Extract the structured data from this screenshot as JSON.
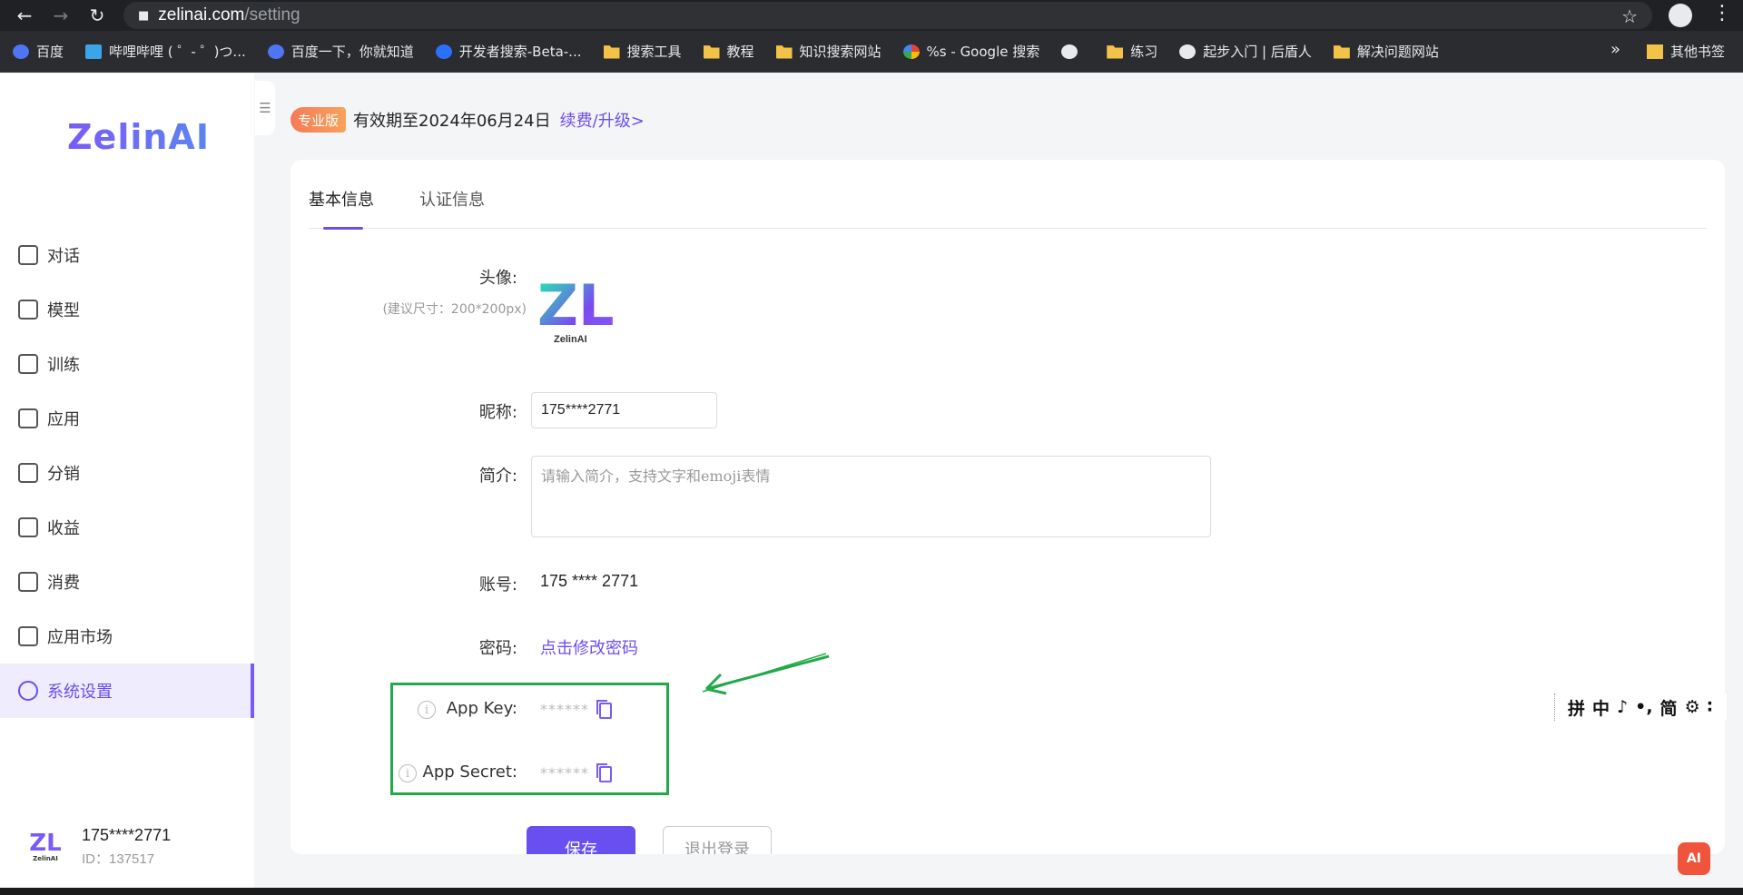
{
  "browser": {
    "url_host": "zelinai.com",
    "url_path": "/setting",
    "bookmarks": [
      {
        "label": "百度",
        "icon": "paw-icon"
      },
      {
        "label": "哔哩哔哩 ( ゜- ゜)つ...",
        "icon": "bilibili-icon"
      },
      {
        "label": "百度一下，你就知道",
        "icon": "paw-icon"
      },
      {
        "label": "开发者搜索-Beta-...",
        "icon": "dev-search-icon"
      },
      {
        "label": "搜索工具",
        "icon": "folder-icon"
      },
      {
        "label": "教程",
        "icon": "folder-icon"
      },
      {
        "label": "知识搜索网站",
        "icon": "folder-icon"
      },
      {
        "label": "%s - Google 搜索",
        "icon": "google-icon"
      },
      {
        "label": "",
        "icon": "globe-icon"
      },
      {
        "label": "练习",
        "icon": "folder-icon"
      },
      {
        "label": "起步入门 | 后盾人",
        "icon": "globe-icon"
      },
      {
        "label": "解决问题网站",
        "icon": "folder-icon"
      }
    ],
    "more_label": "»",
    "other_bookmarks": "其他书签"
  },
  "sidebar": {
    "logo": "ZelinAI",
    "menu": [
      {
        "label": "对话",
        "name": "chat"
      },
      {
        "label": "模型",
        "name": "model"
      },
      {
        "label": "训练",
        "name": "train"
      },
      {
        "label": "应用",
        "name": "apps"
      },
      {
        "label": "分销",
        "name": "distribution"
      },
      {
        "label": "收益",
        "name": "earnings"
      },
      {
        "label": "消费",
        "name": "consumption"
      },
      {
        "label": "应用市场",
        "name": "app-market"
      },
      {
        "label": "系统设置",
        "name": "settings"
      }
    ],
    "user": {
      "avatar_text": "ZL",
      "avatar_sub": "ZelinAI",
      "name": "175****2771",
      "id": "ID：137517"
    }
  },
  "plan": {
    "badge": "专业版",
    "expiry": "有效期至2024年06月24日",
    "renew_link": "续费/升级>"
  },
  "tabs": [
    "基本信息",
    "认证信息"
  ],
  "form": {
    "avatar_label": "头像:",
    "avatar_hint": "(建议尺寸：200*200px)",
    "avatar_text": "ZL",
    "avatar_sub": "ZelinAI",
    "nickname_label": "昵称:",
    "nickname_value": "175****2771",
    "intro_label": "简介:",
    "intro_placeholder": "请输入简介，支持文字和emoji表情",
    "account_label": "账号:",
    "account_value": "175 **** 2771",
    "password_label": "密码:",
    "password_link": "点击修改密码",
    "app_key_label": "App Key:",
    "app_key_value": "******",
    "app_secret_label": "App Secret:",
    "app_secret_value": "******"
  },
  "buttons": {
    "save": "保存",
    "logout": "退出登录"
  },
  "ime": [
    "拼",
    "中",
    "♪",
    "•,",
    "简",
    "⚙",
    "∶"
  ],
  "float_btn": "AI",
  "colors": {
    "accent": "#6a4ff0",
    "highlight": "#23a94a",
    "badge": "#f77a56"
  }
}
